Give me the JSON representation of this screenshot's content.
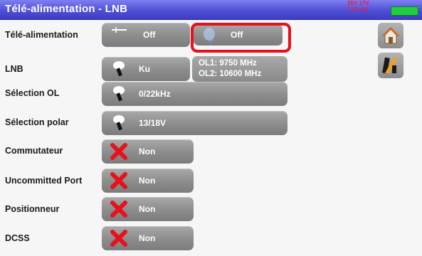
{
  "header": {
    "title": "Télé-alimentation - LNB",
    "status_line1": "25V 17V",
    "status_line2": "0.1A 1H"
  },
  "colors": {
    "title_bar": "#4f4fd6",
    "button": "#8c8c8c",
    "highlight": "#e8101c",
    "battery": "#1fcf3e",
    "cross": "#e8101c"
  },
  "rows": {
    "tele_alimentation": {
      "label": "Télé-alimentation",
      "value1": "Off",
      "value2": "Off"
    },
    "lnb": {
      "label": "LNB",
      "value": "Ku",
      "ol1": "OL1: 9750 MHz",
      "ol2": "OL2: 10600 MHz"
    },
    "selection_ol": {
      "label": "Sélection OL",
      "value": "0/22kHz"
    },
    "selection_polar": {
      "label": "Sélection polar",
      "value": "13/18V"
    },
    "commutateur": {
      "label": "Commutateur",
      "value": "Non"
    },
    "uncommitted_port": {
      "label": "Uncommitted Port",
      "value": "Non"
    },
    "positionneur": {
      "label": "Positionneur",
      "value": "Non"
    },
    "dcss": {
      "label": "DCSS",
      "value": "Non"
    }
  },
  "icons": {
    "home": "home-icon",
    "tools": "tools-icon",
    "satellite_dish": "satellite-dish-icon",
    "cross": "cross-icon"
  }
}
